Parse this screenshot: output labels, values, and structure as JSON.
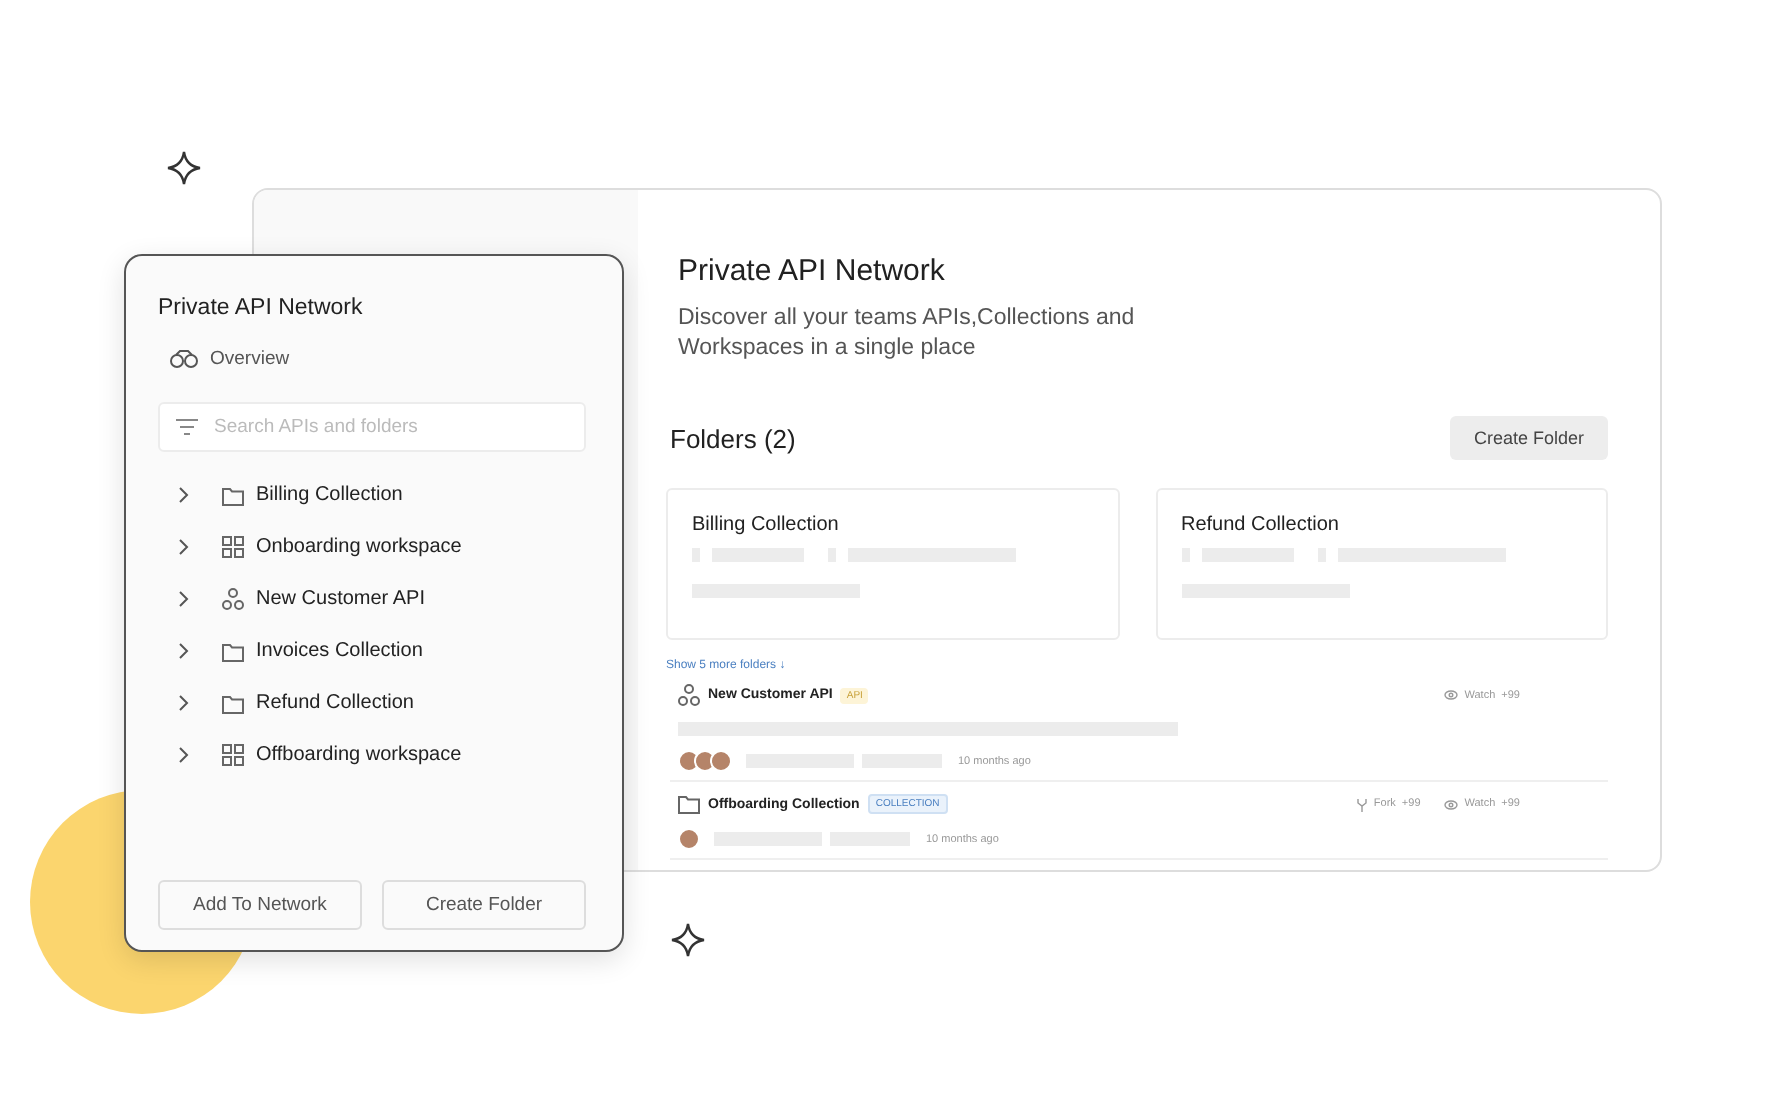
{
  "panel": {
    "title": "Private API Network",
    "overview": "Overview",
    "search": {
      "placeholder": "Search APIs and folders"
    },
    "tree": [
      {
        "kind": "folder",
        "label": "Billing Collection"
      },
      {
        "kind": "workspace",
        "label": "Onboarding workspace"
      },
      {
        "kind": "api",
        "label": "New Customer API"
      },
      {
        "kind": "folder",
        "label": "Invoices Collection"
      },
      {
        "kind": "folder",
        "label": "Refund Collection"
      },
      {
        "kind": "workspace",
        "label": "Offboarding workspace"
      }
    ],
    "buttons": [
      "Add To Network",
      "Create Folder"
    ]
  },
  "main": {
    "title": "Private API Network",
    "subtitle": "Discover all your teams APIs,Collections and Workspaces in a single place",
    "folders_heading": "Folders (2)",
    "create_button": "Create Folder",
    "cards": [
      {
        "title": "Billing Collection"
      },
      {
        "title": "Refund Collection"
      }
    ],
    "show_more": "Show 5 more folders ↓",
    "entries": [
      {
        "kind": "api",
        "name": "New Customer API",
        "tag": "API",
        "time": "10 months ago",
        "stats": [
          {
            "kind": "watch",
            "label": "Watch",
            "count": "+99"
          }
        ]
      },
      {
        "kind": "collection",
        "name": "Offboarding Collection",
        "tag": "COLLECTION",
        "time": "10 months ago",
        "stats": [
          {
            "kind": "fork",
            "label": "Fork",
            "count": "+99"
          },
          {
            "kind": "watch",
            "label": "Watch",
            "count": "+99"
          }
        ]
      }
    ]
  }
}
